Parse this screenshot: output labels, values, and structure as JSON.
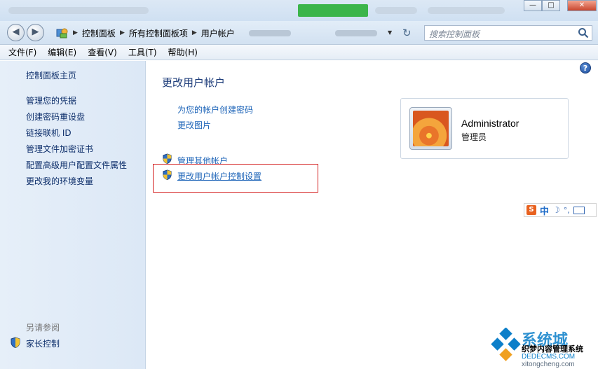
{
  "title_bar": {
    "green_badge": "",
    "controls": [
      "—",
      "□",
      "✕"
    ]
  },
  "address_bar": {
    "crumbs": [
      "控制面板",
      "所有控制面板项",
      "用户帐户"
    ],
    "search_placeholder": "搜索控制面板"
  },
  "menu": [
    {
      "label": "文件(F)"
    },
    {
      "label": "编辑(E)"
    },
    {
      "label": "查看(V)"
    },
    {
      "label": "工具(T)"
    },
    {
      "label": "帮助(H)"
    }
  ],
  "sidebar": {
    "home": "控制面板主页",
    "items": [
      "管理您的凭据",
      "创建密码重设盘",
      "链接联机 ID",
      "管理文件加密证书",
      "配置高级用户配置文件属性",
      "更改我的环境变量"
    ],
    "see_also": "另请参阅",
    "parental": "家长控制"
  },
  "main": {
    "title": "更改用户帐户",
    "links": [
      "为您的帐户创建密码",
      "更改图片"
    ],
    "shield_links": [
      "管理其他帐户",
      "更改用户帐户控制设置"
    ]
  },
  "user": {
    "name": "Administrator",
    "role": "管理员"
  },
  "ime": {
    "logo": "S",
    "lang": "中"
  },
  "watermark": {
    "brand": "系统城",
    "cms": "织梦内容管理系统",
    "site1": "DEDECMS.COM",
    "site2": "xitongcheng.com"
  },
  "colors": {
    "link": "#1d64b8",
    "sidebar_link": "#0e2f6b",
    "highlight_box": "#d42020"
  }
}
